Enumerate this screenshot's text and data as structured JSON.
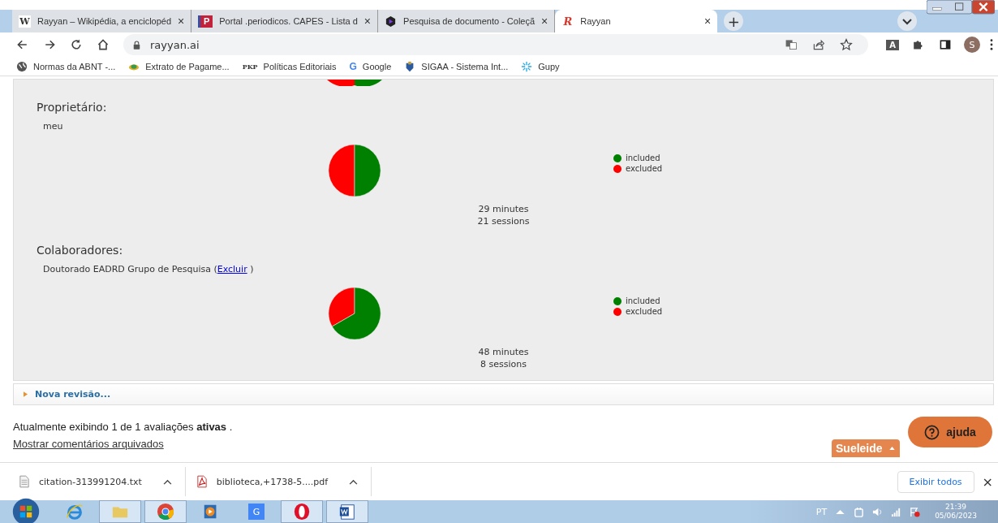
{
  "browser": {
    "tabs": [
      {
        "title": "Rayyan – Wikipédia, a enciclopéd",
        "icon": "W",
        "selected": false
      },
      {
        "title": "Portal .periodicos. CAPES - Lista d",
        "icon": "P",
        "selected": false
      },
      {
        "title": "Pesquisa de documento - Coleçã",
        "selected": false
      },
      {
        "title": "Rayyan",
        "icon": "R",
        "selected": true
      }
    ],
    "new_tab": "+",
    "address": "rayyan.ai",
    "profile": "S",
    "translate_badge": "A",
    "bookmarks": [
      {
        "label": "Normas da ABNT -..."
      },
      {
        "label": "Extrato de Pagame..."
      },
      {
        "label": "Políticas Editoriais",
        "icon": "PKP"
      },
      {
        "label": "Google",
        "icon": "G"
      },
      {
        "label": "SIGAA - Sistema Int..."
      },
      {
        "label": "Gupy"
      }
    ]
  },
  "sections": [
    {
      "heading": "Proprietário:",
      "text_before": "meu",
      "minutes": "29 minutes",
      "sessions": "21 sessions",
      "legend": [
        {
          "label": "included",
          "color": "#008000"
        },
        {
          "label": "excluded",
          "color": "#ff0000"
        }
      ]
    },
    {
      "heading": "Colaboradores:",
      "text_before": "Doutorado EADRD Grupo de Pesquisa (",
      "link": "Excluir",
      "text_after": ")",
      "minutes": "48 minutes",
      "sessions": "8 sessions",
      "legend": [
        {
          "label": "included",
          "color": "#008000"
        },
        {
          "label": "excluded",
          "color": "#ff0000"
        }
      ]
    }
  ],
  "new_review": "Nova revisão...",
  "status_line": "Atualmente exibindo 1 de 1 avaliações **ativas** .",
  "archived_link": "Mostrar comentários arquivados",
  "user_tab": "Sueleide",
  "help_button": "ajuda",
  "downloads": [
    {
      "name": "citation-313991204.txt",
      "kind": "text"
    },
    {
      "name": "biblioteca,+1738-5....pdf",
      "kind": "pdf"
    }
  ],
  "show_all": "Exibir todos",
  "close": "×",
  "taskbar": {
    "apps": [
      {
        "kind": "ie"
      },
      {
        "kind": "folder"
      },
      {
        "kind": "chrome"
      },
      {
        "kind": "media"
      },
      {
        "kind": "docs",
        "label": "G"
      },
      {
        "kind": "opera"
      },
      {
        "kind": "word"
      }
    ],
    "language": "PT",
    "time": "21:39",
    "date": "05/06/2023"
  }
}
